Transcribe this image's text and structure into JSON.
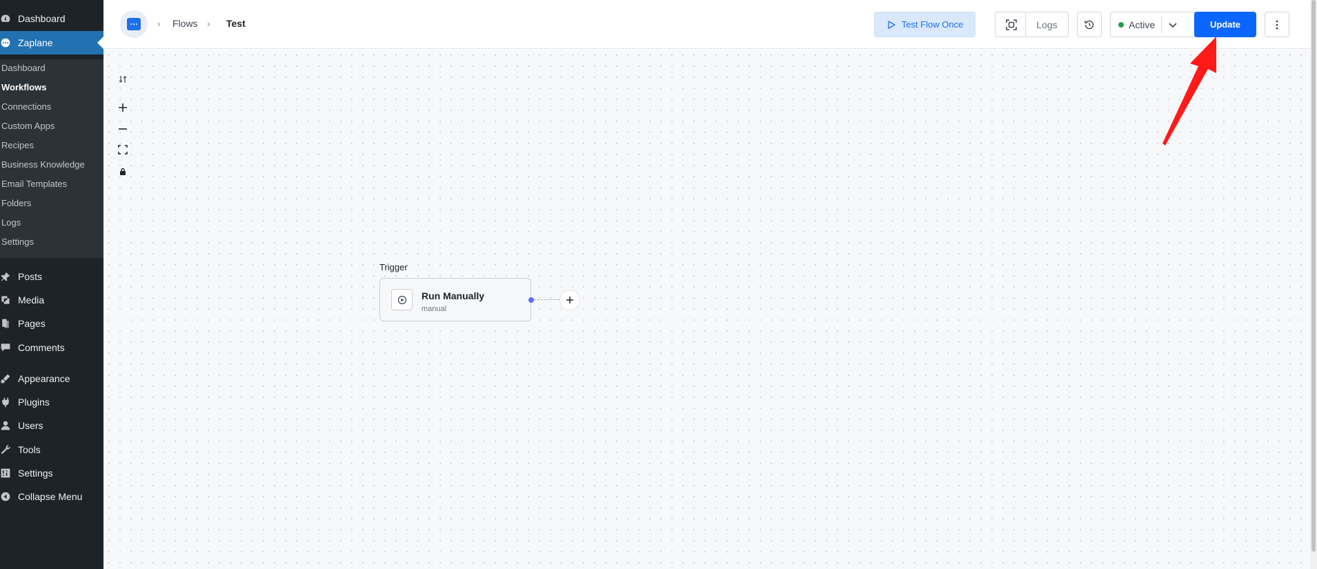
{
  "sidebar": {
    "top_items": [
      {
        "label": "Dashboard",
        "icon": "dashboard-icon"
      },
      {
        "label": "Zaplane",
        "icon": "zaplane-icon",
        "current": true
      }
    ],
    "submenu": [
      "Dashboard",
      "Workflows",
      "Connections",
      "Custom Apps",
      "Recipes",
      "Business Knowledge",
      "Email Templates",
      "Folders",
      "Logs",
      "Settings"
    ],
    "submenu_active": "Workflows",
    "bottom_items": [
      {
        "label": "Posts",
        "icon": "pin-icon"
      },
      {
        "label": "Media",
        "icon": "media-icon"
      },
      {
        "label": "Pages",
        "icon": "pages-icon"
      },
      {
        "label": "Comments",
        "icon": "comment-icon"
      },
      {
        "label": "Appearance",
        "icon": "brush-icon"
      },
      {
        "label": "Plugins",
        "icon": "plugin-icon"
      },
      {
        "label": "Users",
        "icon": "user-icon"
      },
      {
        "label": "Tools",
        "icon": "wrench-icon"
      },
      {
        "label": "Settings",
        "icon": "settings-icon"
      },
      {
        "label": "Collapse Menu",
        "icon": "collapse-icon"
      }
    ]
  },
  "header": {
    "breadcrumb": [
      "Flows",
      "Test"
    ],
    "test_flow_label": "Test Flow Once",
    "logs_label": "Logs",
    "status_label": "Active",
    "update_label": "Update"
  },
  "canvas": {
    "trigger_label": "Trigger",
    "node_title": "Run Manually",
    "node_subtitle": "manual"
  },
  "colors": {
    "wp_sidebar": "#1d2327",
    "wp_highlight": "#2271b1",
    "primary": "#0a66ff",
    "status_green": "#20a34a",
    "annotation_red": "#ff1a1a"
  }
}
